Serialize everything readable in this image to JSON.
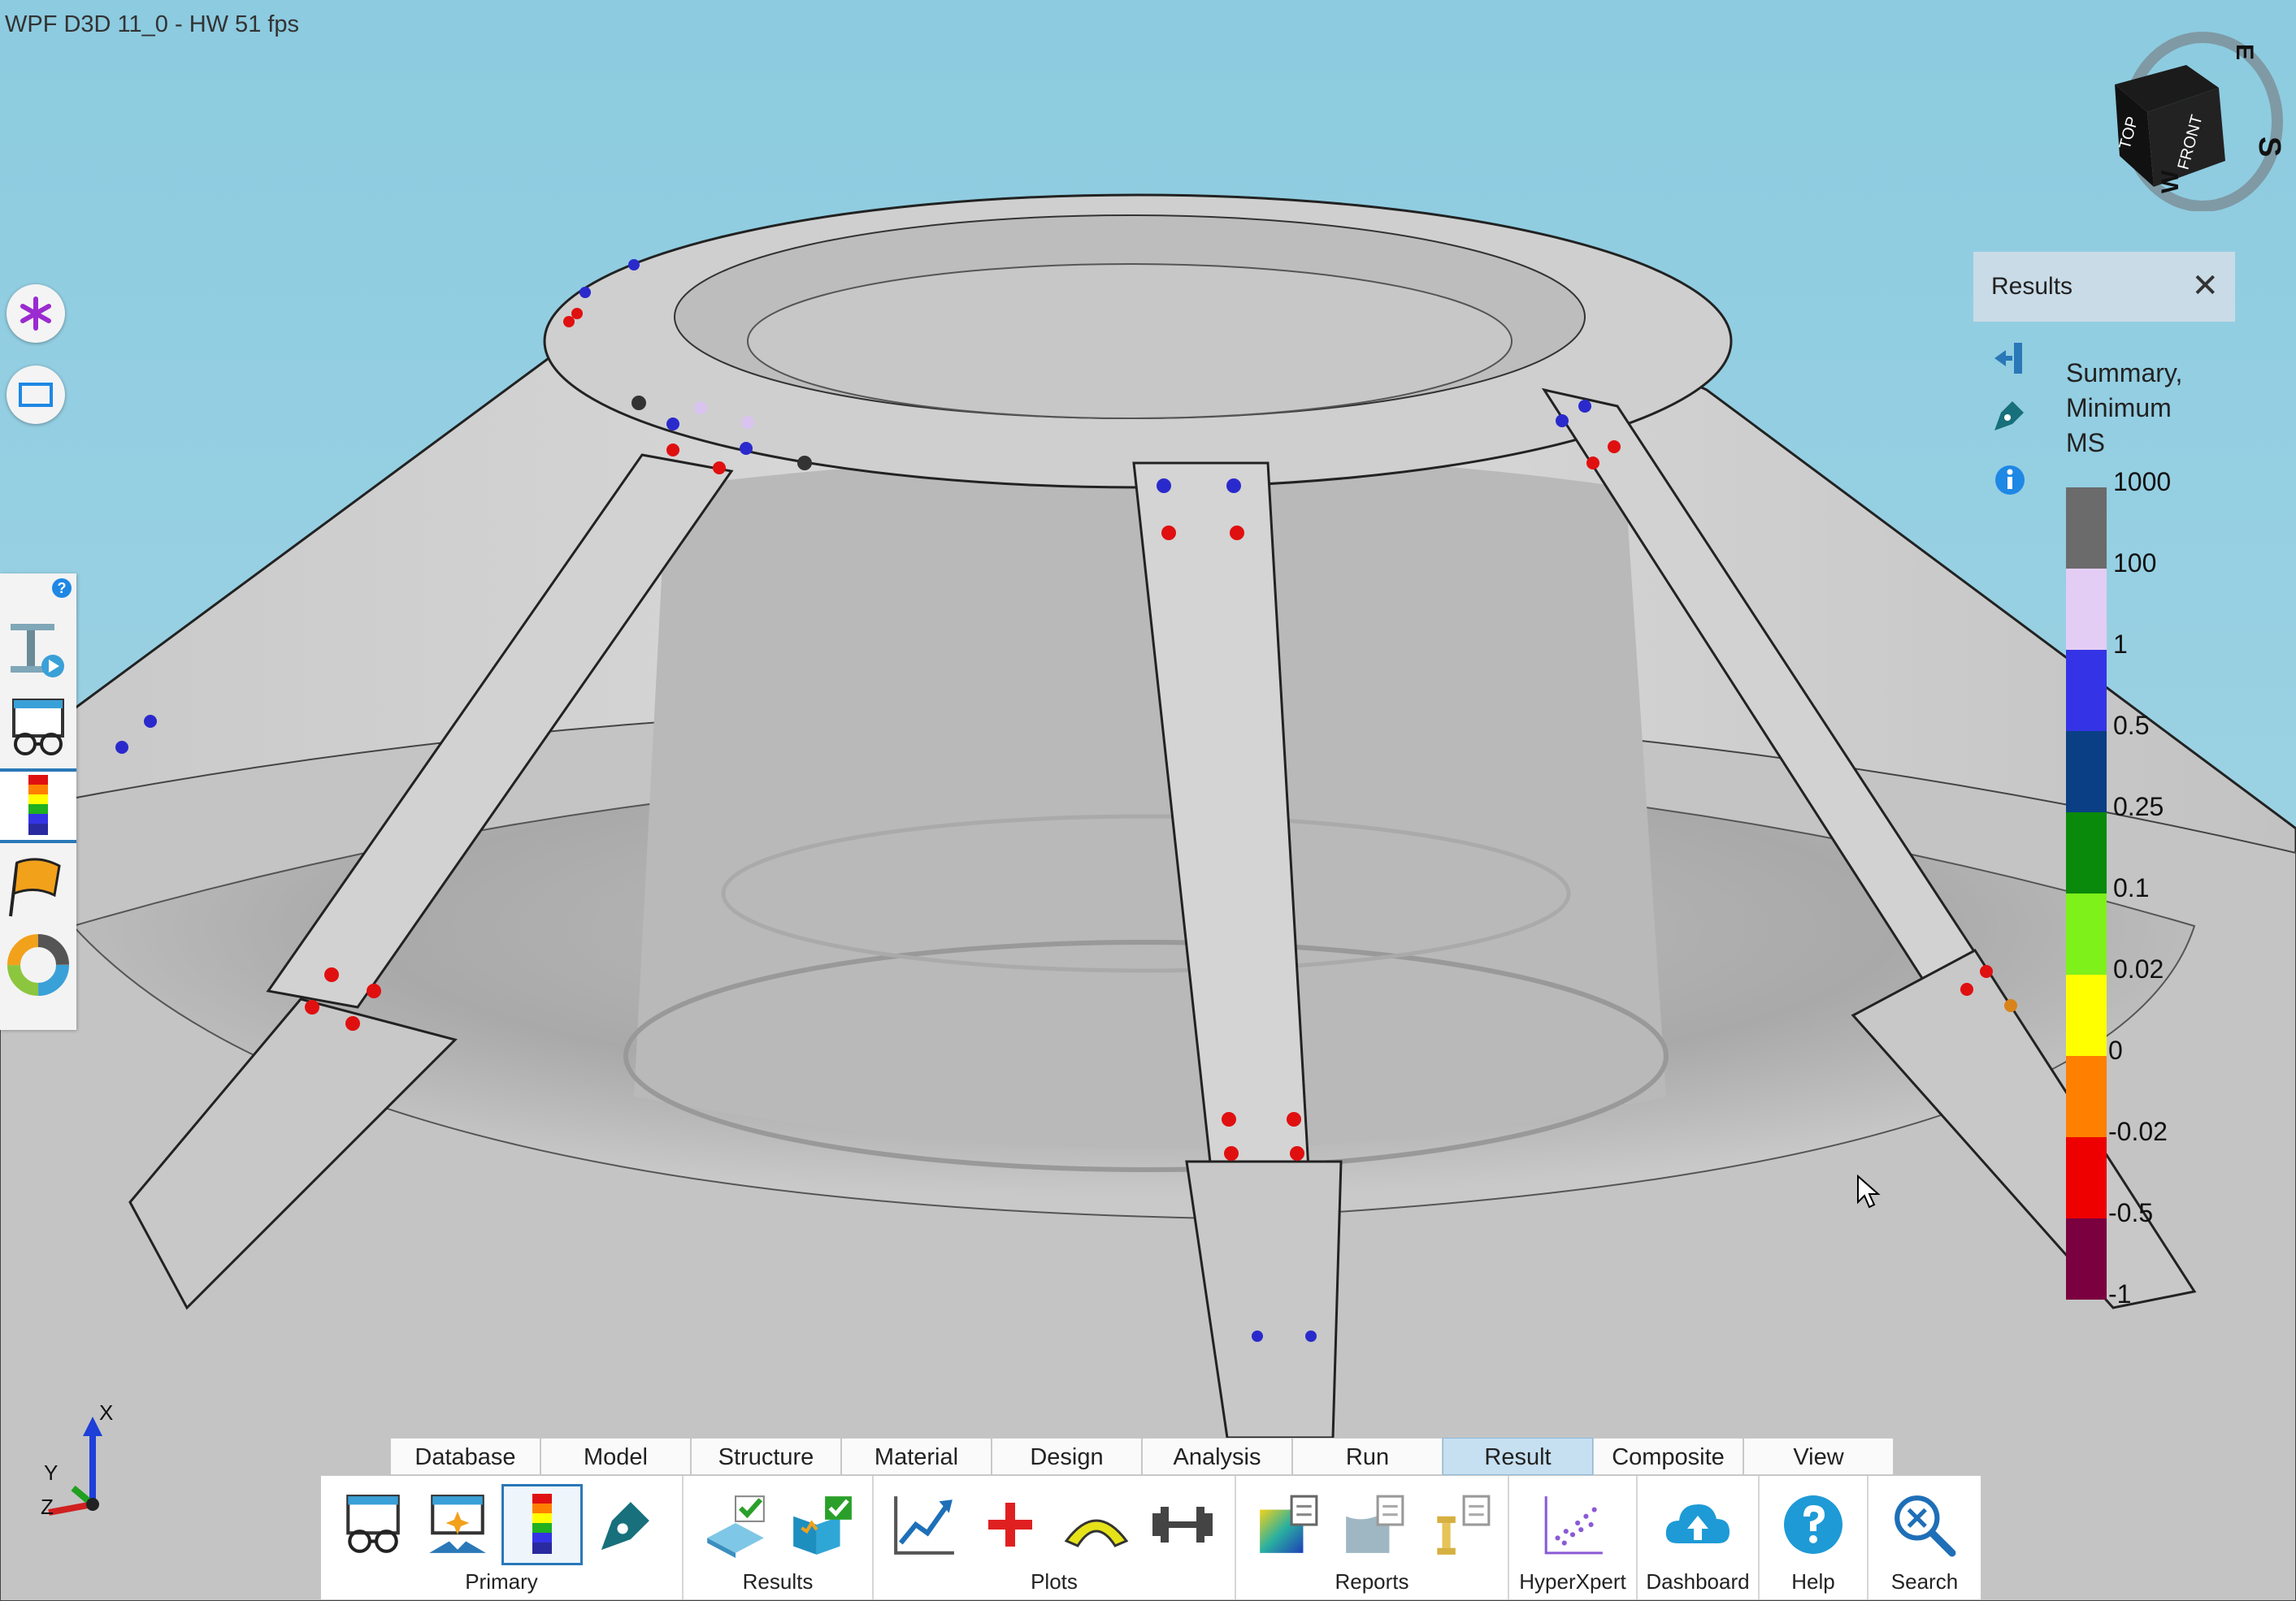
{
  "window": {
    "title": "WPF D3D 11_0 - HW  51 fps"
  },
  "left_tools": {
    "buttons": [
      {
        "name": "asterisk-icon"
      },
      {
        "name": "rectangle-select-icon"
      }
    ],
    "dock_items": [
      {
        "name": "beam-play-icon"
      },
      {
        "name": "glasses-window-icon"
      },
      {
        "name": "contour-legend-icon",
        "selected": true
      },
      {
        "name": "flag-icon"
      },
      {
        "name": "color-wheel-icon"
      }
    ]
  },
  "results_panel": {
    "title": "Results",
    "close_icon": "close-icon",
    "icons": [
      "collapse-panel-icon",
      "pen-icon",
      "info-icon"
    ],
    "summary_label": "Summary, Minimum MS",
    "colorbar": {
      "colors": [
        "#6b6b6b",
        "#e3cdf5",
        "#3434e6",
        "#0a3f86",
        "#0a8a0a",
        "#7ef01a",
        "#ffff00",
        "#ff8000",
        "#ee0000",
        "#7a0040"
      ],
      "labels": [
        "1000",
        "100",
        "1",
        "0.5",
        "0.25",
        "0.1",
        "0.02",
        "0",
        "-0.02",
        "-0.5",
        "-1"
      ]
    }
  },
  "view_cube": {
    "faces": {
      "top": "TOP",
      "front": "FRONT"
    },
    "compass": {
      "east": "E",
      "south": "S",
      "west": "W"
    }
  },
  "triad": {
    "x": "X",
    "y": "Y",
    "z": "Z"
  },
  "ribbon": {
    "tabs": [
      "Database",
      "Model",
      "Structure",
      "Material",
      "Design",
      "Analysis",
      "Run",
      "Result",
      "Composite",
      "View"
    ],
    "active_tab": "Result",
    "groups": [
      {
        "label": "Primary",
        "buttons": [
          "glasses-window-icon",
          "window-sparkle-icon",
          "contour-legend-icon",
          "pen-icon"
        ]
      },
      {
        "label": "Results",
        "buttons": [
          "plate-check-icon",
          "book-check-icon"
        ]
      },
      {
        "label": "Plots",
        "buttons": [
          "line-chart-icon",
          "plus-icon",
          "arc-icon",
          "dumbbell-icon"
        ]
      },
      {
        "label": "Reports",
        "buttons": [
          "contour-report-icon",
          "surface-report-icon",
          "column-report-icon"
        ]
      },
      {
        "label": "HyperXpert",
        "buttons": [
          "scatter-plot-icon"
        ]
      },
      {
        "label": "Dashboard",
        "buttons": [
          "cloud-upload-icon"
        ]
      },
      {
        "label": "Help",
        "buttons": [
          "help-icon"
        ]
      },
      {
        "label": "Search",
        "buttons": [
          "search-icon"
        ]
      }
    ]
  }
}
